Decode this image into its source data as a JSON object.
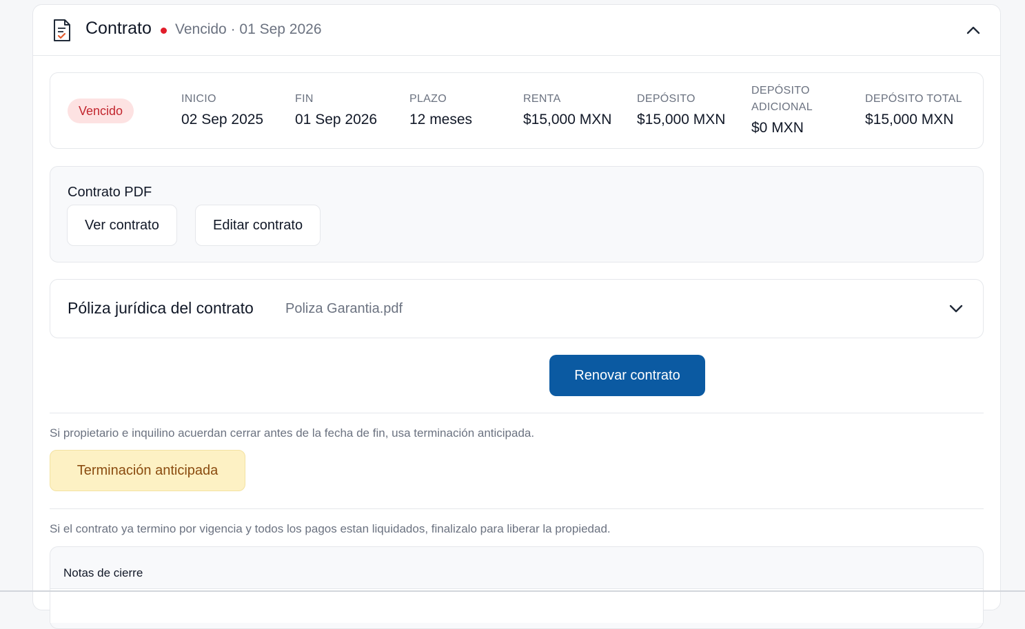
{
  "header": {
    "title": "Contrato",
    "status_text": "Vencido · 01 Sep 2026",
    "status_color": "#e11d2a",
    "icon": "document-icon",
    "collapse_icon": "chevron-up-icon"
  },
  "summary": {
    "badge": "Vencido",
    "stats": [
      {
        "label": "INICIO",
        "value": "02 Sep 2025"
      },
      {
        "label": "FIN",
        "value": "01 Sep 2026"
      },
      {
        "label": "PLAZO",
        "value": "12 meses"
      },
      {
        "label": "RENTA",
        "value": "$15,000 MXN"
      },
      {
        "label": "DEPÓSITO",
        "value": "$15,000 MXN"
      },
      {
        "label": "DEPÓSITO ADICIONAL",
        "value": "$0 MXN"
      },
      {
        "label": "DEPÓSITO TOTAL",
        "value": "$15,000 MXN"
      }
    ]
  },
  "pdf": {
    "title": "Contrato PDF",
    "view_label": "Ver contrato",
    "edit_label": "Editar contrato"
  },
  "poliza": {
    "title": "Póliza jurídica del contrato",
    "file": "Poliza Garantia.pdf",
    "expand_icon": "chevron-down-icon"
  },
  "actions": {
    "renew_label": "Renovar contrato",
    "renew_color": "#0b5aa2",
    "early_note": "Si propietario e inquilino acuerdan cerrar antes de la fecha de fin, usa terminación anticipada.",
    "early_label": "Terminación anticipada",
    "finalize_note": "Si el contrato ya termino por vigencia y todos los pagos estan liquidados, finalizalo para liberar la propiedad."
  },
  "closing": {
    "notes_label": "Notas de cierre"
  }
}
